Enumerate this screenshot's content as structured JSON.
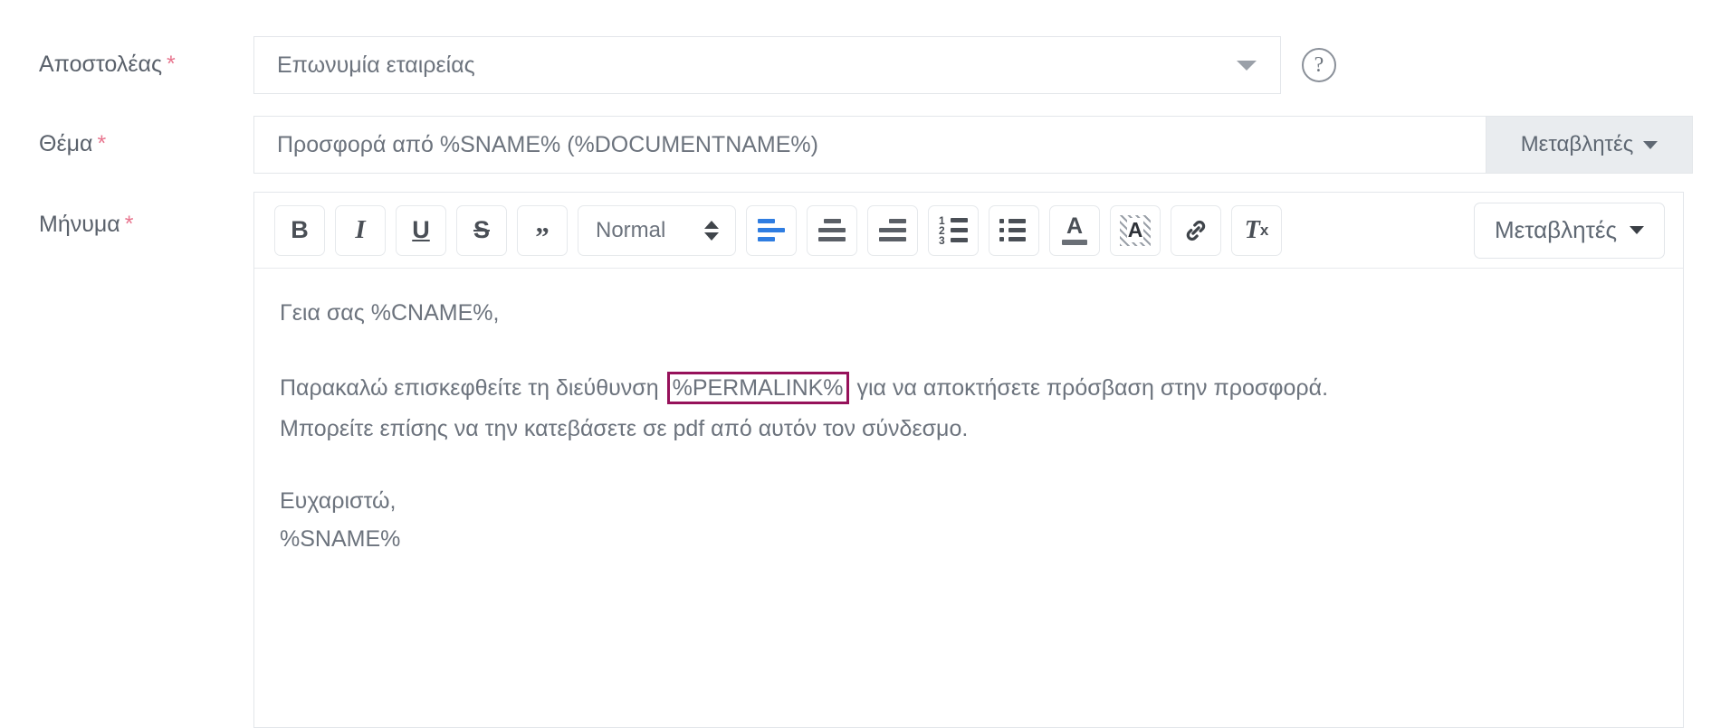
{
  "form": {
    "sender": {
      "label": "Αποστολέας",
      "required_mark": "*",
      "selected_value": "Επωνυμία εταιρείας",
      "help_glyph": "?"
    },
    "subject": {
      "label": "Θέμα",
      "required_mark": "*",
      "value": "Προσφορά από %SNAME% (%DOCUMENTNAME%)",
      "variables_button": "Μεταβλητές"
    },
    "message": {
      "label": "Μήνυμα",
      "required_mark": "*",
      "toolbar": {
        "bold": "B",
        "italic": "I",
        "underline": "U",
        "strikethrough": "S",
        "blockquote": "”",
        "format_select": "Normal",
        "ordered_marks": [
          "1",
          "2",
          "3"
        ],
        "text_color_glyph": "A",
        "background_color_glyph": "A",
        "clear_format_glyph": "T",
        "clear_format_sub": "x",
        "variables_button": "Μεταβλητές"
      },
      "body": {
        "greeting": "Γεια σας %CNAME%,",
        "line_before_token": "Παρακαλώ επισκεφθείτε τη διεύθυνση",
        "token": "%PERMALINK%",
        "line_after_token": "για να αποκτήσετε πρόσβαση στην προσφορά.",
        "line_pdf": "Μπορείτε επίσης να την κατεβάσετε σε pdf από αυτόν τον σύνδεσμο.",
        "closing": "Ευχαριστώ,",
        "signature": "%SNAME%"
      }
    }
  },
  "colors": {
    "required_asterisk": "#e8768f",
    "token_border": "#96115a",
    "active_toolbar": "#2f7de1",
    "label_text": "#5a616b",
    "input_text": "#6c737d",
    "addon_background": "#e9ecef"
  }
}
